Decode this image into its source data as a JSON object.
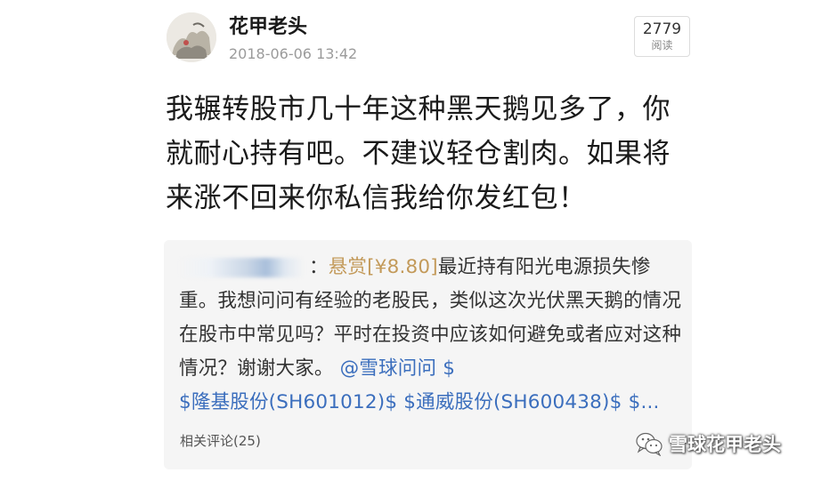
{
  "post": {
    "author": "花甲老头",
    "timestamp": "2018-06-06 13:42",
    "views_count": "2779",
    "views_label": "阅读",
    "body": "我辗转股市几十年这种黑天鹅见多了，你就耐心持有吧。不建议轻仓割肉。如果将来涨不回来你私信我给你发红包！"
  },
  "quoted": {
    "colon": "：",
    "reward": "悬赏[¥8.80]",
    "text": "最近持有阳光电源损失惨重。我想问问有经验的老股民，类似这次光伏黑天鹅的情况在股市中常见吗？平时在投资中应该如何避免或者应对这种情况？谢谢大家。",
    "mention": "@雪球问问",
    "stocks": [
      "$隆基股份(SH601012)$",
      "$通威股份(SH600438)$",
      "$..."
    ],
    "comments": "相关评论(25)"
  },
  "watermark": {
    "text": "雪球花甲老头",
    "icon": "wechat-icon"
  }
}
